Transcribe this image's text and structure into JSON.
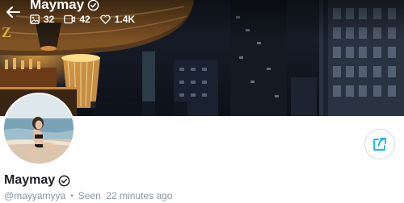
{
  "header": {
    "name": "Maymay",
    "stats": {
      "photos": "32",
      "videos": "42",
      "likes": "1.4K"
    }
  },
  "icons": {
    "back": "arrow-left-icon",
    "verified": "verified-badge-icon",
    "photos": "image-icon",
    "videos": "video-icon",
    "likes": "heart-icon",
    "share": "share-icon"
  },
  "profile": {
    "name": "Maymay",
    "username": "@mayyamyya",
    "separator": "•",
    "seen": "Seen  22 minutes ago"
  },
  "colors": {
    "accent": "#00aff0",
    "muted_text": "#8a96a3",
    "name_text": "#1d1f23"
  }
}
